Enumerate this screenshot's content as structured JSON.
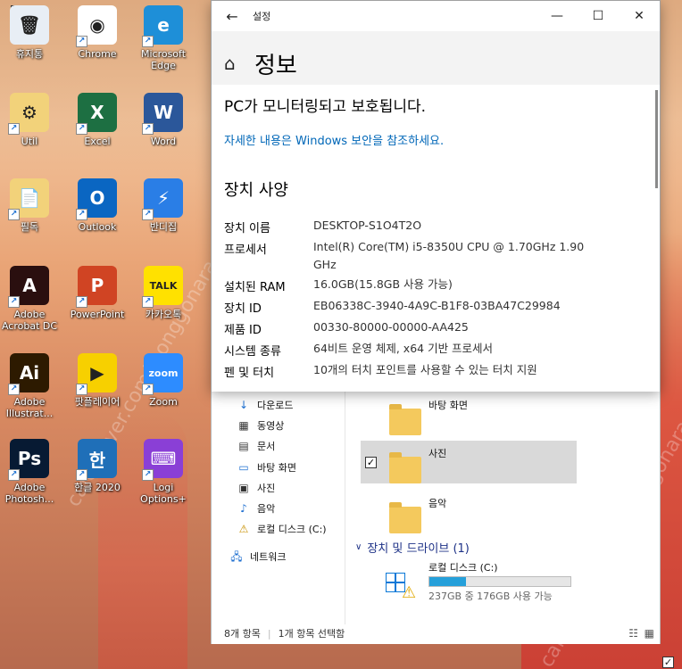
{
  "desktop": {
    "icons": [
      {
        "label": "휴지통",
        "color": "#e8eef5",
        "glyph": "🗑"
      },
      {
        "label": "Chrome",
        "color": "#ffffff",
        "glyph": "◉"
      },
      {
        "label": "Microsoft Edge",
        "color": "#1e8fd8",
        "glyph": "e"
      },
      {
        "label": "Util",
        "color": "#f2d27a",
        "glyph": "⚙"
      },
      {
        "label": "Excel",
        "color": "#1d6f42",
        "glyph": "X"
      },
      {
        "label": "Word",
        "color": "#2b579a",
        "glyph": "W"
      },
      {
        "label": "필독",
        "color": "#f2d27a",
        "glyph": "📄"
      },
      {
        "label": "Outlook",
        "color": "#0a66c2",
        "glyph": "O"
      },
      {
        "label": "반디집",
        "color": "#2a7ee6",
        "glyph": "⚡"
      },
      {
        "label": "Adobe Acrobat DC",
        "color": "#2a0f0f",
        "glyph": "A"
      },
      {
        "label": "PowerPoint",
        "color": "#d04423",
        "glyph": "P"
      },
      {
        "label": "카카오톡",
        "color": "#ffe100",
        "glyph": "TALK"
      },
      {
        "label": "Adobe Illustrat...",
        "color": "#2d1a00",
        "glyph": "Ai"
      },
      {
        "label": "팟플레이어",
        "color": "#f7d000",
        "glyph": "▶"
      },
      {
        "label": "Zoom",
        "color": "#2d8cff",
        "glyph": "zoom"
      },
      {
        "label": "Adobe Photosh...",
        "color": "#071a33",
        "glyph": "Ps"
      },
      {
        "label": "한글 2020",
        "color": "#1f6fb8",
        "glyph": "한"
      },
      {
        "label": "Logi Options+",
        "color": "#8a3fd6",
        "glyph": "⌨"
      }
    ]
  },
  "settings": {
    "window_title": "설정",
    "page_title": "정보",
    "protect_text": "PC가 모니터링되고 보호됩니다.",
    "security_link": "자세한 내용은 Windows 보안을 참조하세요.",
    "section_title": "장치 사양",
    "specs": [
      {
        "label": "장치 이름",
        "value": "DESKTOP-S1O4T2O"
      },
      {
        "label": "프로세서",
        "value": "Intel(R) Core(TM) i5-8350U CPU @ 1.70GHz   1.90 GHz"
      },
      {
        "label": "설치된 RAM",
        "value": "16.0GB(15.8GB 사용 가능)"
      },
      {
        "label": "장치 ID",
        "value": "EB06338C-3940-4A9C-B1F8-03BA47C29984"
      },
      {
        "label": "제품 ID",
        "value": "00330-80000-00000-AA425"
      },
      {
        "label": "시스템 종류",
        "value": "64비트 운영 체제, x64 기반 프로세서"
      },
      {
        "label": "펜 및 터치",
        "value": "10개의 터치 포인트를 사용할 수 있는 터치 지원"
      }
    ]
  },
  "explorer": {
    "nav": [
      {
        "label": "다운로드",
        "icon": "↓"
      },
      {
        "label": "동영상",
        "icon": "▦"
      },
      {
        "label": "문서",
        "icon": "▤"
      },
      {
        "label": "바탕 화면",
        "icon": "▭"
      },
      {
        "label": "사진",
        "icon": "▣"
      },
      {
        "label": "음악",
        "icon": "♪"
      },
      {
        "label": "로컬 디스크 (C:)",
        "icon": "⚠"
      },
      {
        "label": "네트워크",
        "icon": "🖧"
      }
    ],
    "folders": [
      {
        "label": "바탕 화면"
      },
      {
        "label": "사진"
      },
      {
        "label": "음악"
      }
    ],
    "devices_header": "장치 및 드라이브 (1)",
    "drive": {
      "name": "로컬 디스크 (C:)",
      "info": "237GB 중 176GB 사용 가능",
      "used_fraction": 0.26
    },
    "status": {
      "count": "8개 항목",
      "selected": "1개 항목 선택함"
    }
  }
}
